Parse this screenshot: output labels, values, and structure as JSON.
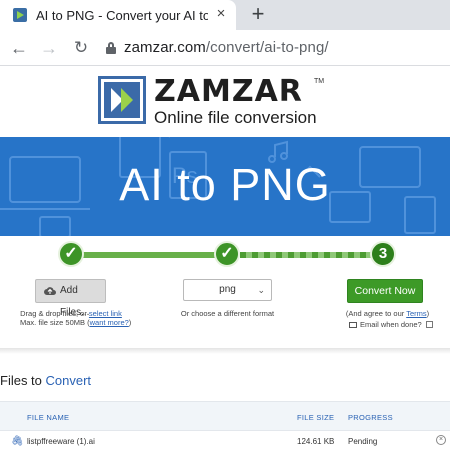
{
  "browser": {
    "tab_title": "AI to PNG - Convert your AI to PN",
    "tab_close": "×",
    "new_tab": "+",
    "url_domain": "zamzar.com",
    "url_path": "/convert/ai-to-png/"
  },
  "brand": {
    "logo_text": "ZAMZAR",
    "tm": "TM",
    "tagline": "Online file conversion"
  },
  "banner": {
    "title": "AI to PNG"
  },
  "steps": [
    {
      "label": "✓",
      "state": "done"
    },
    {
      "label": "✓",
      "state": "done"
    },
    {
      "label": "3",
      "state": "current"
    }
  ],
  "step1": {
    "button_label": "Add Files...",
    "hint_line1_prefix": "Drag & drop files, or ",
    "hint_link": "select link",
    "hint_line2_prefix": "Max. file size 50MB (",
    "hint_more": "want more?",
    "hint_line2_suffix": ")"
  },
  "step2": {
    "selected_format": "png",
    "hint": "Or choose a different format"
  },
  "step3": {
    "button_label": "Convert Now",
    "terms_prefix": "(And agree to our ",
    "terms_link": "Terms",
    "terms_suffix": ")",
    "email_label": "Email when done?"
  },
  "files": {
    "heading_prefix": "Files to ",
    "heading_highlight": "Convert",
    "columns": {
      "name": "FILE NAME",
      "size": "FILE SIZE",
      "progress": "PROGRESS"
    },
    "rows": [
      {
        "name": "listpffreeware (1).ai",
        "size": "124.61 KB",
        "progress": "Pending"
      }
    ]
  },
  "colors": {
    "brand_blue": "#2774c8",
    "success_green": "#3d9a27",
    "link_blue": "#2a62b4"
  }
}
